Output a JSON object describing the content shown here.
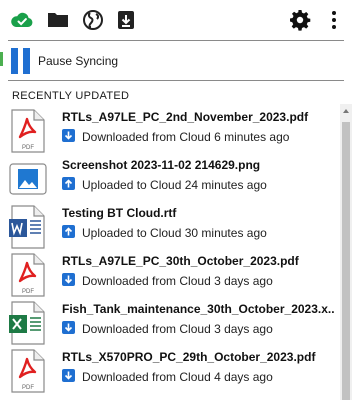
{
  "toolbar": {
    "icons": [
      "cloud-check-icon",
      "folder-icon",
      "globe-icon",
      "download-icon",
      "gear-icon",
      "more-vertical-icon"
    ]
  },
  "pause": {
    "label": "Pause Syncing",
    "icon": "pause-icon"
  },
  "section": {
    "title": "RECENTLY UPDATED"
  },
  "files": [
    {
      "name": "RTLs_A97LE_PC_2nd_November_2023.pdf",
      "type": "pdf",
      "direction": "down",
      "status": "Downloaded from Cloud 6 minutes ago"
    },
    {
      "name": "Screenshot 2023-11-02 214629.png",
      "type": "image",
      "direction": "up",
      "status": "Uploaded to Cloud 24 minutes ago"
    },
    {
      "name": "Testing BT Cloud.rtf",
      "type": "word",
      "direction": "up",
      "status": "Uploaded to Cloud 30 minutes ago"
    },
    {
      "name": "RTLs_A97LE_PC_30th_October_2023.pdf",
      "type": "pdf",
      "direction": "down",
      "status": "Downloaded from Cloud 3 days ago"
    },
    {
      "name": "Fish_Tank_maintenance_30th_October_2023.x...",
      "type": "excel",
      "direction": "down",
      "status": "Downloaded from Cloud 3 days ago"
    },
    {
      "name": "RTLs_X570PRO_PC_29th_October_2023.pdf",
      "type": "pdf",
      "direction": "down",
      "status": "Downloaded from Cloud 4 days ago"
    }
  ],
  "file_icon_labels": {
    "pdf": "PDF"
  },
  "colors": {
    "accent": "#1f6fd1",
    "pdf": "#e02020",
    "excel": "#1e7a45",
    "word": "#2b579a",
    "sync_ok": "#1aa04a"
  }
}
